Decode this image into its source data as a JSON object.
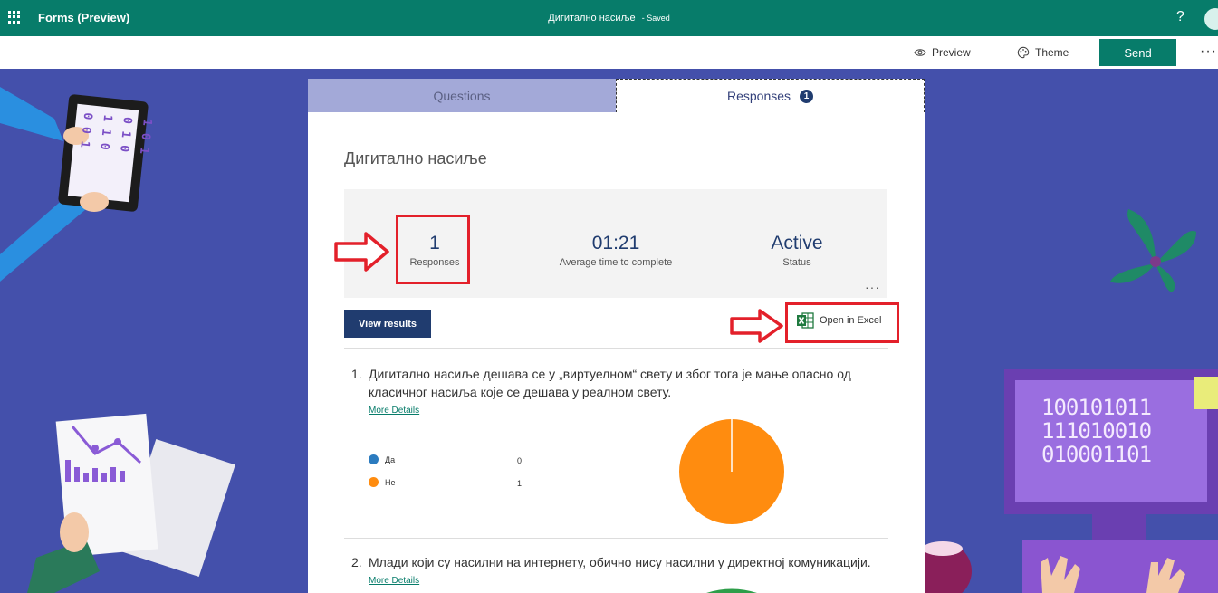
{
  "topbar": {
    "app_title": "Forms (Preview)",
    "doc_title": "Дигитално насиље",
    "saved_label": "- Saved",
    "help_label": "?"
  },
  "commands": {
    "preview_label": "Preview",
    "theme_label": "Theme",
    "send_label": "Send",
    "more_label": "···"
  },
  "tabs": {
    "questions_label": "Questions",
    "responses_label": "Responses",
    "responses_badge": "1"
  },
  "form": {
    "title": "Дигитално насиље"
  },
  "stats": {
    "responses_value": "1",
    "responses_label": "Responses",
    "avg_time_value": "01:21",
    "avg_time_label": "Average time to complete",
    "status_value": "Active",
    "status_label": "Status",
    "more_label": "···"
  },
  "actions": {
    "view_results_label": "View results",
    "open_excel_label": "Open in Excel"
  },
  "questions": [
    {
      "number": "1.",
      "line1": "Дигитално насиље дешава се у „виртуелном“ свету и због тога је мање опасно од",
      "line2": "класичног насиља које се дешава у реалном свету.",
      "more_details": "More Details",
      "options": [
        {
          "label": "Да",
          "value": "0",
          "color": "#2b7bbf"
        },
        {
          "label": "Не",
          "value": "1",
          "color": "#ff8c0f"
        }
      ]
    },
    {
      "number": "2.",
      "line1": "Млади који су насилни на интернету, обично нису насилни у директној комуникацији.",
      "more_details": "More Details"
    }
  ],
  "illustrations": {
    "binary_tablet": [
      "1 0 1",
      "0 1 0",
      "1 1 0",
      "0 0 1"
    ],
    "binary_monitor": [
      "100101011",
      "111010010",
      "010001101"
    ]
  },
  "colors": {
    "topbar": "#077c6a",
    "background": "#4450ab",
    "accent_dark": "#203c6f",
    "highlight": "#e3202a",
    "tab_inactive": "#a3a9d8"
  }
}
